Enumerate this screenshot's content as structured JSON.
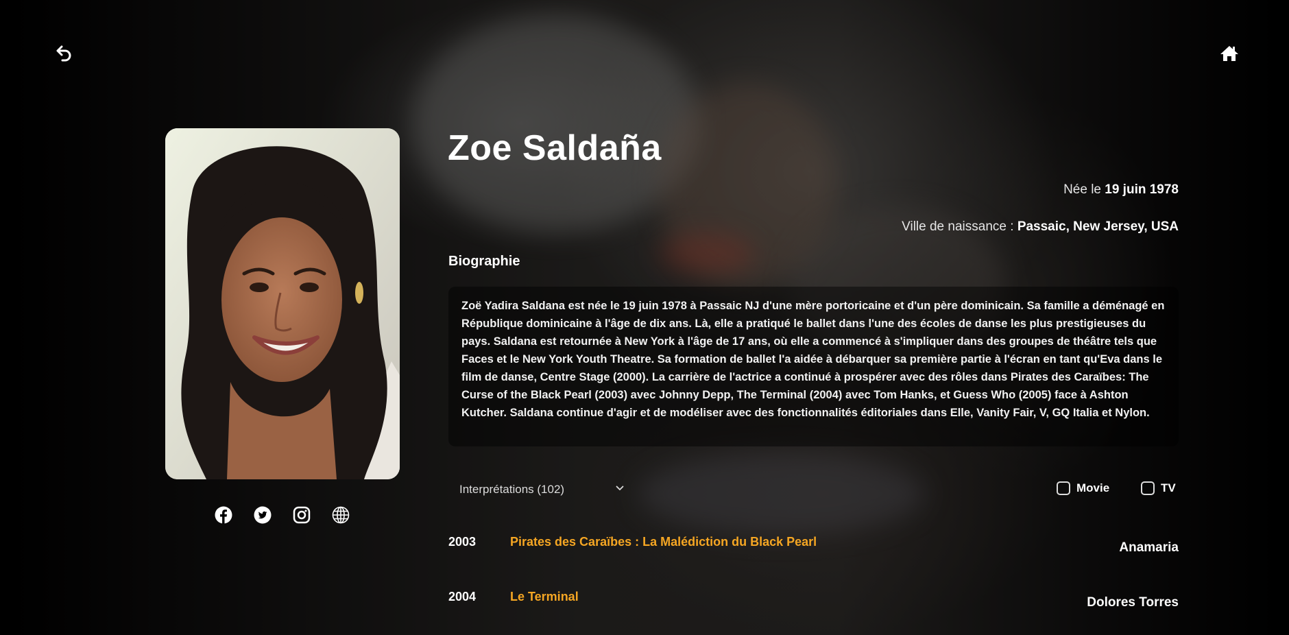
{
  "nav": {
    "back_icon": "undo-arrow-icon",
    "home_icon": "home-icon"
  },
  "person": {
    "name": "Zoe Saldaña",
    "born_label": "Née le",
    "born_value": "19 juin 1978",
    "birthplace_label": "Ville de naissance :",
    "birthplace_value": "Passaic, New Jersey, USA"
  },
  "socials": [
    "facebook-icon",
    "twitter-icon",
    "instagram-icon",
    "globe-icon"
  ],
  "biography": {
    "title": "Biographie",
    "text": "Zoë Yadira Saldana est née le 19 juin 1978 à Passaic NJ d'une mère portoricaine et d'un père dominicain. Sa famille a déménagé en République dominicaine à l'âge de dix ans. Là, elle a pratiqué le ballet dans l'une des écoles de danse les plus prestigieuses du pays. Saldana est retournée à New York à l'âge de 17 ans, où elle a commencé à s'impliquer dans des groupes de théâtre tels que Faces et le New York Youth Theatre. Sa formation de ballet l'a aidée à débarquer sa première partie à l'écran en tant qu'Eva dans le film de danse, Centre Stage (2000). La carrière de l'actrice a continué à prospérer avec des rôles dans Pirates des Caraïbes: The Curse of the Black Pearl (2003) avec Johnny Depp, The Terminal (2004) avec Tom Hanks, et Guess Who (2005) face à Ashton Kutcher. Saldana continue d'agir et de modéliser avec des fonctionnalités éditoriales dans Elle, Vanity Fair, V, GQ Italia et Nylon."
  },
  "filters": {
    "select_label": "Interprétations (102)",
    "movie_label": "Movie",
    "movie_checked": false,
    "tv_label": "TV",
    "tv_checked": false
  },
  "roles": [
    {
      "year": "2003",
      "title": "Pirates des Caraïbes : La Malédiction du Black Pearl",
      "character": "Anamaria"
    },
    {
      "year": "2004",
      "title": "Le Terminal",
      "character": "Dolores Torres"
    }
  ],
  "colors": {
    "accent": "#f5a623",
    "background": "#050505",
    "text": "#ffffff"
  }
}
